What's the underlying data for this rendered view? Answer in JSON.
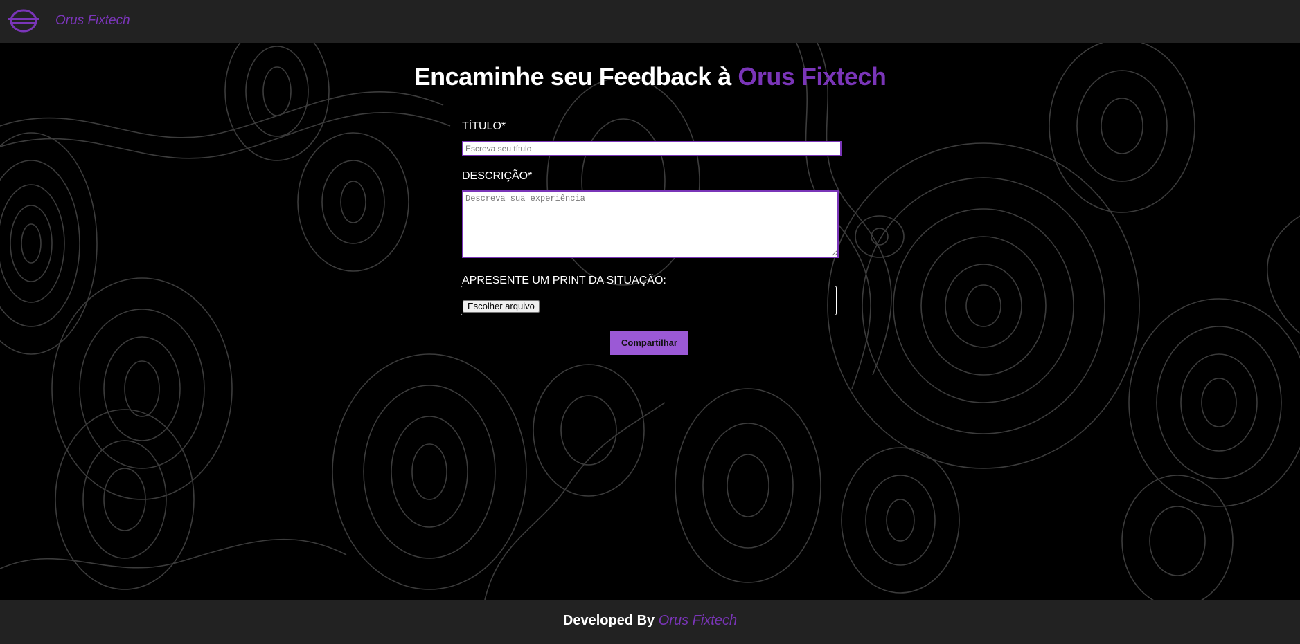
{
  "header": {
    "brand": "Orus Fixtech",
    "logo_icon": "orus-logo-icon"
  },
  "main": {
    "title_prefix": "Encaminhe seu Feedback à ",
    "title_accent": "Orus Fixtech",
    "form": {
      "title_label": "TÍTULO*",
      "title_placeholder": "Escreva seu título",
      "description_label": "DESCRIÇÃO*",
      "description_placeholder": "Descreva sua experiência",
      "file_label": "APRESENTE UM PRINT DA SITUAÇÃO:",
      "file_button": "Escolher arquivo",
      "submit_label": "Compartilhar"
    }
  },
  "footer": {
    "prefix": "Developed By ",
    "accent": "Orus Fixtech"
  },
  "colors": {
    "accent": "#7a35b8",
    "button": "#9b59d6",
    "bar": "#222222",
    "background": "#000000",
    "contour": "#3a3a3a"
  }
}
